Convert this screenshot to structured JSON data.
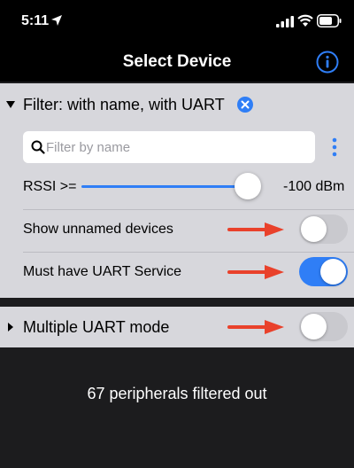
{
  "status_bar": {
    "time": "5:11",
    "icons": [
      "location-arrow-icon",
      "cellular-signal-icon",
      "wifi-icon",
      "battery-icon"
    ]
  },
  "nav": {
    "title": "Select Device",
    "info_icon": "info-circle-icon"
  },
  "filter": {
    "title": "Filter: with name, with UART",
    "search_placeholder": "Filter by name",
    "search_value": "",
    "rssi_label": "RSSI >=",
    "rssi_value": "-100 dBm",
    "rssi_slider_fraction": 0.92,
    "rows": [
      {
        "label": "Show unnamed devices",
        "toggle_on": false
      },
      {
        "label": "Must have UART Service",
        "toggle_on": true
      }
    ]
  },
  "multiple_uart": {
    "label": "Multiple UART mode",
    "toggle_on": false
  },
  "footer": {
    "filtered_out": "67 peripherals filtered out"
  },
  "colors": {
    "accent": "#2f7ef6",
    "annotation_arrow": "#e9412b",
    "section_background": "#d7d7dc",
    "page_background": "#1c1c1e"
  }
}
